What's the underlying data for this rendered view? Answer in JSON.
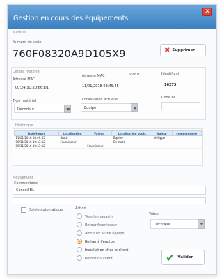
{
  "window": {
    "title": "Gestion en cours des équipements"
  },
  "material": {
    "section_label": "Materiel",
    "serial_label": "Numero de serie",
    "serial_value": "760F08320A9D105X9",
    "delete_label": "Supprimer"
  },
  "details": {
    "section_label": "Détails matériel",
    "mac_address_label": "Adresse MAC",
    "mac_address_label_2": "Adresse MAC",
    "mac_value": "00:24:3D:20:66:D1",
    "mac_date": "11/01/2018 08:49:45",
    "status_label": "Statut",
    "identifier_label": "Identifiant",
    "identifier_value": "16273",
    "material_type_label": "Type matériel",
    "material_type_value": "Décodeur",
    "current_location_label": "Localisation actuelle",
    "current_location_value": "Equipe",
    "bl_code_label": "Code BL"
  },
  "history": {
    "section_label": "Historique",
    "columns": [
      "Date/heure",
      "Localisation",
      "Valeur",
      "Localisation souh.",
      "Valeur",
      "commentaire"
    ],
    "rows": [
      [
        "11/01/2018 08:49:45",
        "Stock",
        "",
        "Equipe",
        "pHilippe",
        ""
      ],
      [
        "09/11/2016 10:43:12",
        "Fournisseur",
        "",
        "En stock",
        "",
        ""
      ],
      [
        "09/11/2016 10:43:12",
        "",
        "Fournisseur",
        "",
        "",
        ""
      ]
    ]
  },
  "movement": {
    "section_label": "Mouvement",
    "comments_label": "Commentaire",
    "comments_value": "Conseil BL",
    "auto_input_label": "Saisie automatique",
    "action_label": "Action",
    "actions": [
      {
        "label": "Vers le magasin",
        "selected": false
      },
      {
        "label": "Retour fournisseur",
        "selected": false
      },
      {
        "label": "Attribuer à une équipe",
        "selected": false
      },
      {
        "label": "Retirer à l'équipe",
        "selected": true
      },
      {
        "label": "Installation chez le client",
        "selected": false
      },
      {
        "label": "Retour du client",
        "selected": false
      }
    ],
    "value_label": "Valeur",
    "value_selected": "Décodeur",
    "validate_label": "Valider"
  }
}
